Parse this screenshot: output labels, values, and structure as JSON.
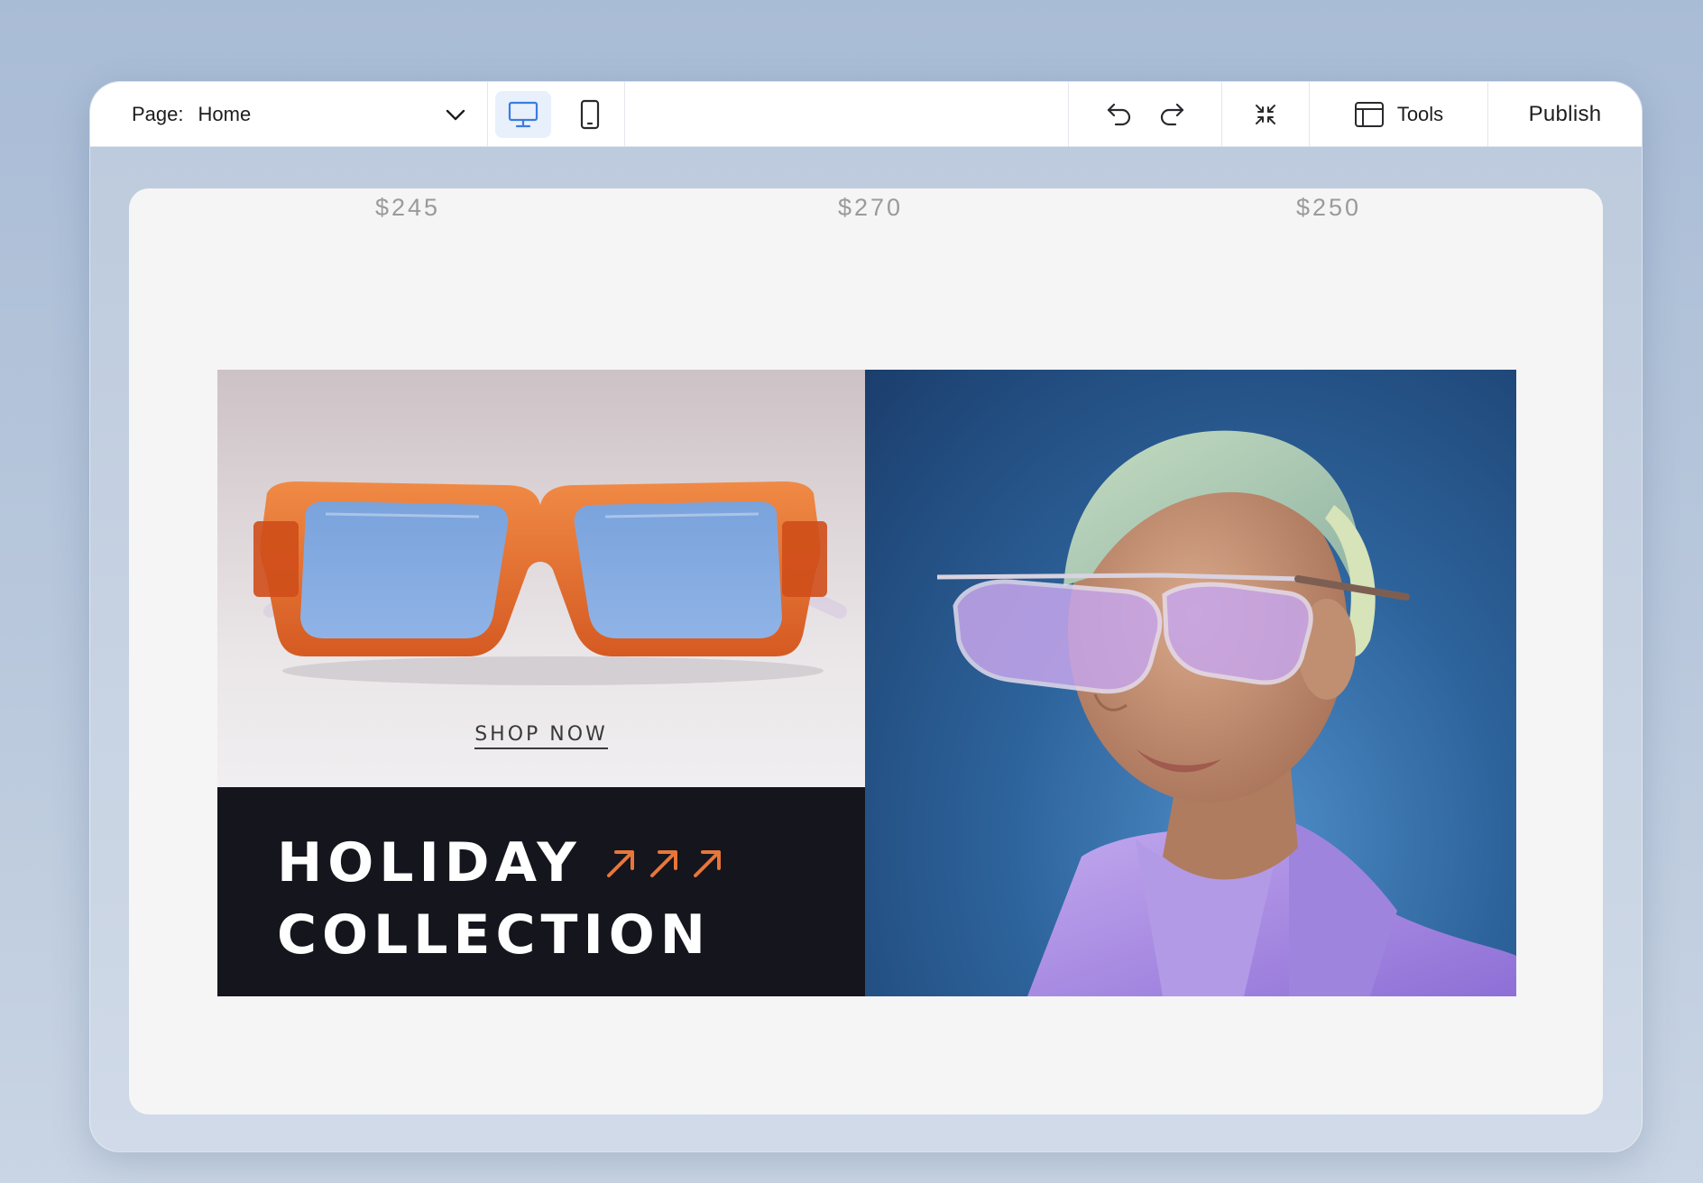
{
  "toolbar": {
    "page_label": "Page:",
    "page_value": "Home",
    "tools_label": "Tools",
    "publish_label": "Publish"
  },
  "canvas": {
    "prices": [
      "$245",
      "$270",
      "$250"
    ]
  },
  "banner": {
    "shop_now": "SHOP NOW",
    "title_line1": "HOLIDAY",
    "title_line2": "COLLECTION"
  },
  "colors": {
    "accent_blue": "#3b7be0",
    "arrow_orange": "#e8763a",
    "dark_block": "#15151d",
    "frame_orange": "#e2672d",
    "lens_blue": "#7fa7dd",
    "jacket_purple": "#a98ae0"
  },
  "icons": {
    "dropdown": "chevron-down-icon",
    "desktop": "desktop-icon",
    "mobile": "mobile-icon",
    "undo": "undo-icon",
    "redo": "redo-icon",
    "zoom": "collapse-icon",
    "tools": "layout-panel-icon"
  }
}
